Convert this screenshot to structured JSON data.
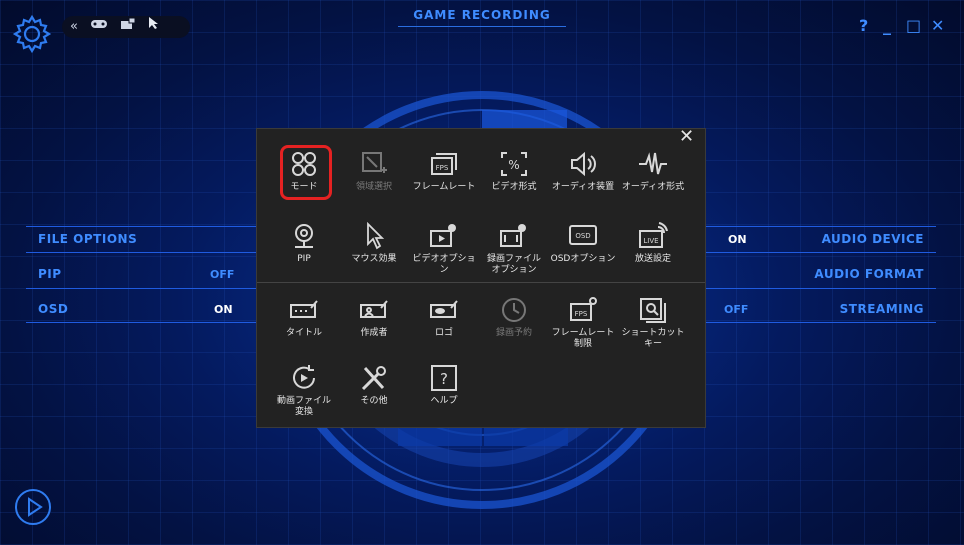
{
  "header": {
    "title": "GAME RECORDING",
    "toolbar_icons": [
      "collapse-icon",
      "gamepad-icon",
      "record-region-icon",
      "cursor-icon"
    ],
    "window_controls": {
      "help": "?",
      "minimize": "_",
      "maximize": "□",
      "close": "✕"
    }
  },
  "left_panel": {
    "rows": [
      {
        "label": "FILE OPTIONS",
        "value": ""
      },
      {
        "label": "PIP",
        "value": "OFF"
      },
      {
        "label": "OSD",
        "value": "ON"
      }
    ]
  },
  "right_panel": {
    "rows": [
      {
        "label": "AUDIO DEVICE",
        "value": "ON"
      },
      {
        "label": "AUDIO FORMAT",
        "value": ""
      },
      {
        "label": "STREAMING",
        "value": "OFF"
      }
    ]
  },
  "menu": {
    "close": "✕",
    "items": [
      {
        "label": "モード",
        "icon": "mode-icon",
        "selected": true
      },
      {
        "label": "領域選択",
        "icon": "region-select-icon",
        "disabled": true
      },
      {
        "label": "フレームレート",
        "icon": "fps-icon"
      },
      {
        "label": "ビデオ形式",
        "icon": "video-format-icon"
      },
      {
        "label": "オーディオ装置",
        "icon": "speaker-icon"
      },
      {
        "label": "オーディオ形式",
        "icon": "waveform-icon"
      },
      {
        "label": "PIP",
        "icon": "webcam-icon"
      },
      {
        "label": "マウス効果",
        "icon": "cursor-icon"
      },
      {
        "label": "ビデオオプション",
        "icon": "video-options-icon"
      },
      {
        "label": "録画ファイル\nオプション",
        "icon": "file-options-icon"
      },
      {
        "label": "OSDオプション",
        "icon": "osd-icon"
      },
      {
        "label": "放送設定",
        "icon": "live-icon"
      },
      {
        "label": "タイトル",
        "icon": "title-icon"
      },
      {
        "label": "作成者",
        "icon": "author-icon"
      },
      {
        "label": "ロゴ",
        "icon": "logo-icon"
      },
      {
        "label": "録画予約",
        "icon": "schedule-icon",
        "disabled": true
      },
      {
        "label": "フレームレート\n制限",
        "icon": "fps-limit-icon"
      },
      {
        "label": "ショートカット\nキー",
        "icon": "shortcut-icon"
      },
      {
        "label": "動画ファイル\n変換",
        "icon": "convert-icon"
      },
      {
        "label": "その他",
        "icon": "tools-icon"
      },
      {
        "label": "ヘルプ",
        "icon": "help-icon"
      }
    ]
  },
  "footer": {
    "play_icon": "play-icon"
  },
  "colors": {
    "accent": "#3f8cff",
    "popup_bg": "#222222",
    "highlight": "#e52222"
  }
}
